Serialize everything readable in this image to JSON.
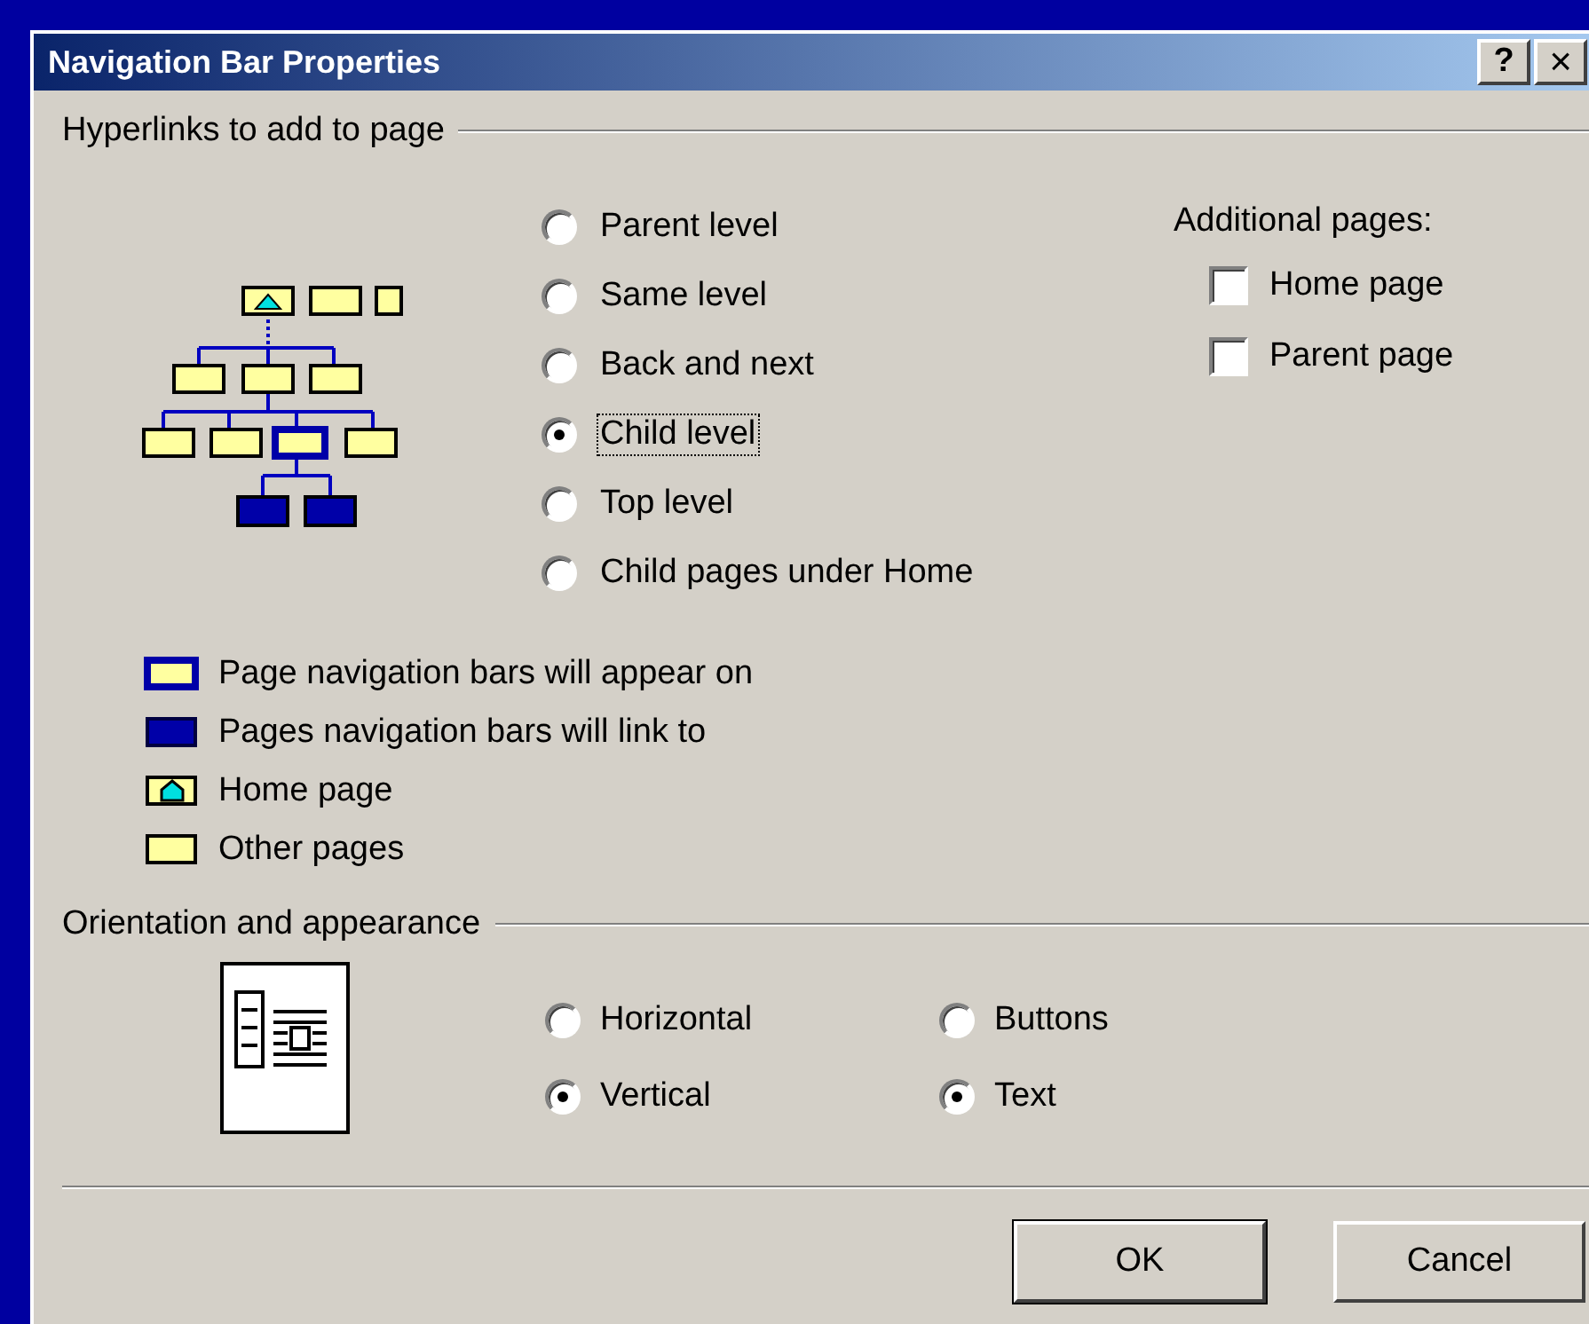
{
  "window": {
    "title": "Navigation Bar Properties",
    "controls": [
      {
        "kind": "help",
        "label": "?"
      },
      {
        "kind": "close",
        "label": "×"
      }
    ]
  },
  "hyperlinks": {
    "heading": "Hyperlinks to add to page",
    "options": [
      {
        "label": "Parent level",
        "selected": false,
        "focused": false
      },
      {
        "label": "Same level",
        "selected": false,
        "focused": false
      },
      {
        "label": "Back and next",
        "selected": false,
        "focused": false
      },
      {
        "label": "Child level",
        "selected": true,
        "focused": true
      },
      {
        "label": "Top level",
        "selected": false,
        "focused": false
      },
      {
        "label": "Child pages under Home",
        "selected": false,
        "focused": false
      }
    ],
    "additional": {
      "heading": "Additional pages:",
      "items": [
        {
          "label": "Home page",
          "checked": false
        },
        {
          "label": "Parent page",
          "checked": false
        }
      ]
    }
  },
  "legend": [
    {
      "kind": "current",
      "label": "Page navigation bars will appear on"
    },
    {
      "kind": "link",
      "label": "Pages navigation bars will link to"
    },
    {
      "kind": "home",
      "label": "Home page"
    },
    {
      "kind": "other",
      "label": "Other pages"
    }
  ],
  "orientation": {
    "heading": "Orientation and appearance",
    "layout": [
      {
        "label": "Horizontal",
        "selected": false
      },
      {
        "label": "Vertical",
        "selected": true
      }
    ],
    "style": [
      {
        "label": "Buttons",
        "selected": false
      },
      {
        "label": "Text",
        "selected": true
      }
    ]
  },
  "buttons": [
    {
      "label": "OK",
      "kind": "default"
    },
    {
      "label": "Cancel",
      "kind": "normal"
    }
  ]
}
